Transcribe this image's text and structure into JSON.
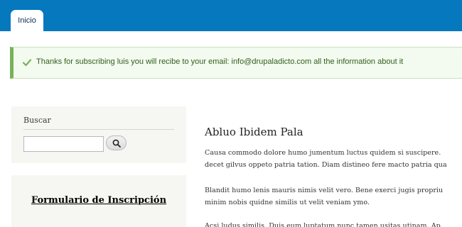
{
  "header": {
    "tabs": [
      {
        "label": "Inicio"
      }
    ]
  },
  "status_message": {
    "text": "Thanks for subscribing luis you will recibe to your email: info@drupaladicto.com all the information about it",
    "icon": "checkmark-icon",
    "color": "#77b259"
  },
  "sidebar": {
    "search_block": {
      "title": "Buscar",
      "input_value": "",
      "button_icon": "search-icon"
    },
    "form_block": {
      "title": "Formulario de Inscripción"
    }
  },
  "main": {
    "article_title": "Abluo Ibidem Pala",
    "paragraphs": [
      {
        "lines": [
          "Causa commodo dolore humo jumentum luctus quidem si suscipere.",
          "decet gilvus oppeto patria tation. Diam distineo fere macto patria qua"
        ]
      },
      {
        "lines": [
          "Blandit humo lenis mauris nimis velit vero. Bene exerci jugis propriu",
          "minim nobis quidne similis ut velit veniam ymo."
        ]
      },
      {
        "lines": [
          "Acsi ludus similis. Duis eum luptatum nunc tamen usitas utinam. Ap"
        ]
      }
    ]
  },
  "colors": {
    "header_blue": "#0678be",
    "success_border": "#77b259",
    "sidebar_bg": "#f6f6f2"
  }
}
